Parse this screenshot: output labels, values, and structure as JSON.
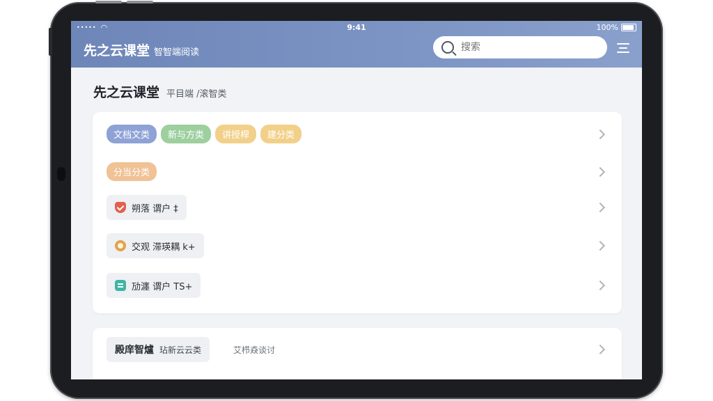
{
  "status_bar": {
    "signal": "•••••",
    "time": "9:41",
    "battery": "100%"
  },
  "header": {
    "app_title": "先之云课堂",
    "app_subtitle": "智智端阅读",
    "search_placeholder": "搜索"
  },
  "page": {
    "title": "先之云课堂",
    "subtitle": "平目端 /滚智类"
  },
  "categories": {
    "tags_row1": [
      "文档文类",
      "新与方类",
      "讲授桿",
      "建分类"
    ],
    "tags_row2": [
      "分当分类"
    ],
    "items": [
      {
        "label": "朔落 谓户 ‡",
        "icon": "shield-check-icon"
      },
      {
        "label": "交观 滞瑛耦 k+",
        "icon": "badge-icon"
      },
      {
        "label": "劢瀍 谓户 TS+",
        "icon": "document-icon"
      }
    ]
  },
  "second_card": {
    "chip_main": "殿庠智爐",
    "chip_sub": "玷新云云类",
    "secondary": "艾栉猋谈讨"
  },
  "colors": {
    "header_start": "#6e86b8",
    "header_end": "#8aa0cc",
    "tag_blue": "#8ea2d6",
    "tag_green": "#9dcf9f",
    "tag_yellow": "#f2d08a",
    "tag_orange": "#f0c296"
  }
}
